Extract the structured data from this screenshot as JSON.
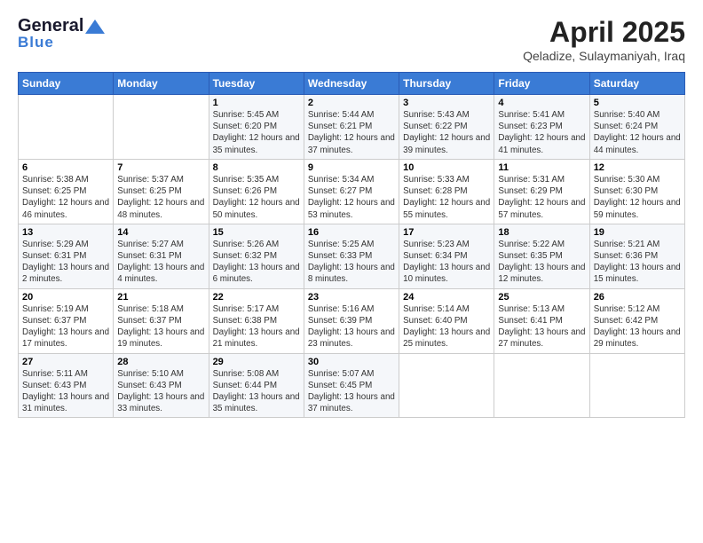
{
  "logo": {
    "general": "General",
    "blue": "Blue"
  },
  "title": "April 2025",
  "subtitle": "Qeladize, Sulaymaniyah, Iraq",
  "days_of_week": [
    "Sunday",
    "Monday",
    "Tuesday",
    "Wednesday",
    "Thursday",
    "Friday",
    "Saturday"
  ],
  "weeks": [
    [
      {
        "day": "",
        "sunrise": "",
        "sunset": "",
        "daylight": ""
      },
      {
        "day": "",
        "sunrise": "",
        "sunset": "",
        "daylight": ""
      },
      {
        "day": "1",
        "sunrise": "Sunrise: 5:45 AM",
        "sunset": "Sunset: 6:20 PM",
        "daylight": "Daylight: 12 hours and 35 minutes."
      },
      {
        "day": "2",
        "sunrise": "Sunrise: 5:44 AM",
        "sunset": "Sunset: 6:21 PM",
        "daylight": "Daylight: 12 hours and 37 minutes."
      },
      {
        "day": "3",
        "sunrise": "Sunrise: 5:43 AM",
        "sunset": "Sunset: 6:22 PM",
        "daylight": "Daylight: 12 hours and 39 minutes."
      },
      {
        "day": "4",
        "sunrise": "Sunrise: 5:41 AM",
        "sunset": "Sunset: 6:23 PM",
        "daylight": "Daylight: 12 hours and 41 minutes."
      },
      {
        "day": "5",
        "sunrise": "Sunrise: 5:40 AM",
        "sunset": "Sunset: 6:24 PM",
        "daylight": "Daylight: 12 hours and 44 minutes."
      }
    ],
    [
      {
        "day": "6",
        "sunrise": "Sunrise: 5:38 AM",
        "sunset": "Sunset: 6:25 PM",
        "daylight": "Daylight: 12 hours and 46 minutes."
      },
      {
        "day": "7",
        "sunrise": "Sunrise: 5:37 AM",
        "sunset": "Sunset: 6:25 PM",
        "daylight": "Daylight: 12 hours and 48 minutes."
      },
      {
        "day": "8",
        "sunrise": "Sunrise: 5:35 AM",
        "sunset": "Sunset: 6:26 PM",
        "daylight": "Daylight: 12 hours and 50 minutes."
      },
      {
        "day": "9",
        "sunrise": "Sunrise: 5:34 AM",
        "sunset": "Sunset: 6:27 PM",
        "daylight": "Daylight: 12 hours and 53 minutes."
      },
      {
        "day": "10",
        "sunrise": "Sunrise: 5:33 AM",
        "sunset": "Sunset: 6:28 PM",
        "daylight": "Daylight: 12 hours and 55 minutes."
      },
      {
        "day": "11",
        "sunrise": "Sunrise: 5:31 AM",
        "sunset": "Sunset: 6:29 PM",
        "daylight": "Daylight: 12 hours and 57 minutes."
      },
      {
        "day": "12",
        "sunrise": "Sunrise: 5:30 AM",
        "sunset": "Sunset: 6:30 PM",
        "daylight": "Daylight: 12 hours and 59 minutes."
      }
    ],
    [
      {
        "day": "13",
        "sunrise": "Sunrise: 5:29 AM",
        "sunset": "Sunset: 6:31 PM",
        "daylight": "Daylight: 13 hours and 2 minutes."
      },
      {
        "day": "14",
        "sunrise": "Sunrise: 5:27 AM",
        "sunset": "Sunset: 6:31 PM",
        "daylight": "Daylight: 13 hours and 4 minutes."
      },
      {
        "day": "15",
        "sunrise": "Sunrise: 5:26 AM",
        "sunset": "Sunset: 6:32 PM",
        "daylight": "Daylight: 13 hours and 6 minutes."
      },
      {
        "day": "16",
        "sunrise": "Sunrise: 5:25 AM",
        "sunset": "Sunset: 6:33 PM",
        "daylight": "Daylight: 13 hours and 8 minutes."
      },
      {
        "day": "17",
        "sunrise": "Sunrise: 5:23 AM",
        "sunset": "Sunset: 6:34 PM",
        "daylight": "Daylight: 13 hours and 10 minutes."
      },
      {
        "day": "18",
        "sunrise": "Sunrise: 5:22 AM",
        "sunset": "Sunset: 6:35 PM",
        "daylight": "Daylight: 13 hours and 12 minutes."
      },
      {
        "day": "19",
        "sunrise": "Sunrise: 5:21 AM",
        "sunset": "Sunset: 6:36 PM",
        "daylight": "Daylight: 13 hours and 15 minutes."
      }
    ],
    [
      {
        "day": "20",
        "sunrise": "Sunrise: 5:19 AM",
        "sunset": "Sunset: 6:37 PM",
        "daylight": "Daylight: 13 hours and 17 minutes."
      },
      {
        "day": "21",
        "sunrise": "Sunrise: 5:18 AM",
        "sunset": "Sunset: 6:37 PM",
        "daylight": "Daylight: 13 hours and 19 minutes."
      },
      {
        "day": "22",
        "sunrise": "Sunrise: 5:17 AM",
        "sunset": "Sunset: 6:38 PM",
        "daylight": "Daylight: 13 hours and 21 minutes."
      },
      {
        "day": "23",
        "sunrise": "Sunrise: 5:16 AM",
        "sunset": "Sunset: 6:39 PM",
        "daylight": "Daylight: 13 hours and 23 minutes."
      },
      {
        "day": "24",
        "sunrise": "Sunrise: 5:14 AM",
        "sunset": "Sunset: 6:40 PM",
        "daylight": "Daylight: 13 hours and 25 minutes."
      },
      {
        "day": "25",
        "sunrise": "Sunrise: 5:13 AM",
        "sunset": "Sunset: 6:41 PM",
        "daylight": "Daylight: 13 hours and 27 minutes."
      },
      {
        "day": "26",
        "sunrise": "Sunrise: 5:12 AM",
        "sunset": "Sunset: 6:42 PM",
        "daylight": "Daylight: 13 hours and 29 minutes."
      }
    ],
    [
      {
        "day": "27",
        "sunrise": "Sunrise: 5:11 AM",
        "sunset": "Sunset: 6:43 PM",
        "daylight": "Daylight: 13 hours and 31 minutes."
      },
      {
        "day": "28",
        "sunrise": "Sunrise: 5:10 AM",
        "sunset": "Sunset: 6:43 PM",
        "daylight": "Daylight: 13 hours and 33 minutes."
      },
      {
        "day": "29",
        "sunrise": "Sunrise: 5:08 AM",
        "sunset": "Sunset: 6:44 PM",
        "daylight": "Daylight: 13 hours and 35 minutes."
      },
      {
        "day": "30",
        "sunrise": "Sunrise: 5:07 AM",
        "sunset": "Sunset: 6:45 PM",
        "daylight": "Daylight: 13 hours and 37 minutes."
      },
      {
        "day": "",
        "sunrise": "",
        "sunset": "",
        "daylight": ""
      },
      {
        "day": "",
        "sunrise": "",
        "sunset": "",
        "daylight": ""
      },
      {
        "day": "",
        "sunrise": "",
        "sunset": "",
        "daylight": ""
      }
    ]
  ]
}
